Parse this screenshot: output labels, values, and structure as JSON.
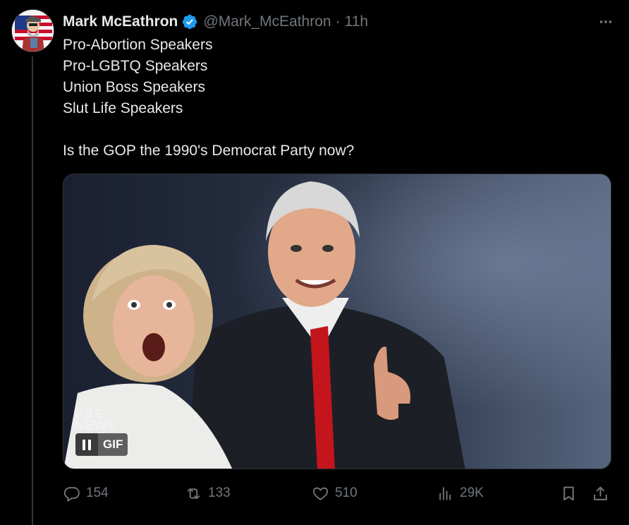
{
  "tweet": {
    "author": {
      "name": "Mark McEathron",
      "handle": "@Mark_McEathron",
      "verified": true,
      "avatar_icon": "cartoon-man-american-flag-avatar"
    },
    "separator": "·",
    "timestamp": "11h",
    "text_lines": [
      "Pro-Abortion Speakers",
      "Pro-LGBTQ Speakers",
      "Union Boss Speakers",
      "Slut Life Speakers"
    ],
    "text_question": "Is the GOP the 1990's Democrat Party now?",
    "media": {
      "type": "gif",
      "watermark_line1": "PBS",
      "watermark_line2": "NEWS",
      "gif_badge": "GIF",
      "pause_icon": "pause-icon"
    },
    "actions": {
      "replies": "154",
      "retweets": "133",
      "likes": "510",
      "views": "29K"
    }
  },
  "colors": {
    "background": "#000000",
    "text_primary": "#e7e9ea",
    "text_secondary": "#71767b",
    "verified_blue": "#1d9bf0",
    "divider": "#2f3336"
  }
}
